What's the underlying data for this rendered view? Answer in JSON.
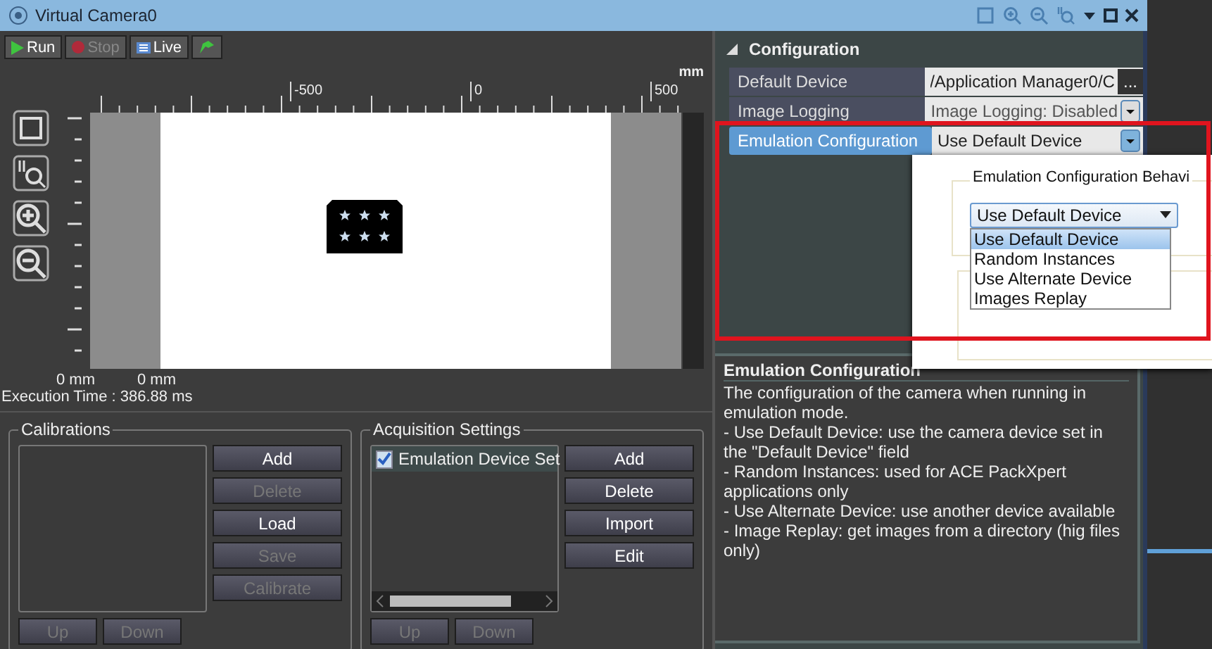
{
  "window": {
    "title": "Virtual Camera0"
  },
  "toolbar": [
    {
      "kind": "run",
      "label": "Run",
      "disabled": false
    },
    {
      "kind": "stop",
      "label": "Stop",
      "disabled": true
    },
    {
      "kind": "live",
      "label": "Live",
      "disabled": false
    },
    {
      "kind": "flag"
    }
  ],
  "ruler": {
    "unit": "mm",
    "ticks": [
      "-500",
      "0",
      "500"
    ]
  },
  "readouts": [
    "0 mm",
    "0 mm"
  ],
  "execution_time": "Execution Time : 386.88 ms",
  "calibrations": {
    "title": "Calibrations",
    "buttons": [
      {
        "label": "Add",
        "disabled": false
      },
      {
        "label": "Delete",
        "disabled": true
      },
      {
        "label": "Load",
        "disabled": false
      },
      {
        "label": "Save",
        "disabled": true
      },
      {
        "label": "Calibrate",
        "disabled": true
      }
    ],
    "nav": [
      {
        "label": "Up",
        "disabled": true
      },
      {
        "label": "Down",
        "disabled": true
      }
    ]
  },
  "acquisition": {
    "title": "Acquisition Settings",
    "items": [
      {
        "label": "Emulation Device Set",
        "checked": true
      }
    ],
    "buttons": [
      {
        "label": "Add",
        "disabled": false
      },
      {
        "label": "Delete",
        "disabled": false
      },
      {
        "label": "Import",
        "disabled": false
      },
      {
        "label": "Edit",
        "disabled": false
      }
    ],
    "nav": [
      {
        "label": "Up",
        "disabled": true
      },
      {
        "label": "Down",
        "disabled": true
      }
    ]
  },
  "configuration": {
    "title": "Configuration",
    "expanded": true,
    "properties": [
      {
        "name": "Default Device",
        "value": "/Application Manager0/C",
        "kind": "browse",
        "browse_label": "...",
        "selected": false
      },
      {
        "name": "Image Logging",
        "value": "Image Logging: Disabled",
        "kind": "dropdown",
        "selected": false
      },
      {
        "name": "Emulation Configuration",
        "value": "Use Default Device",
        "kind": "dropdown",
        "selected": true
      }
    ]
  },
  "popup": {
    "group_title": "Emulation Configuration Behavi",
    "combo_value": "Use Default Device",
    "options": [
      {
        "label": "Use Default Device",
        "selected": true
      },
      {
        "label": "Random Instances",
        "selected": false
      },
      {
        "label": "Use Alternate Device",
        "selected": false
      },
      {
        "label": "Images Replay",
        "selected": false
      }
    ]
  },
  "help": {
    "title": "Emulation Configuration",
    "paragraphs": [
      "The configuration of the camera when running in emulation mode.",
      "- Use Default Device: use the camera device set in the \"Default Device\" field",
      "- Random Instances: used for ACE PackXpert applications only",
      "- Use Alternate Device: use another device available",
      "- Image Replay: get images from a directory (hig files only)"
    ]
  }
}
